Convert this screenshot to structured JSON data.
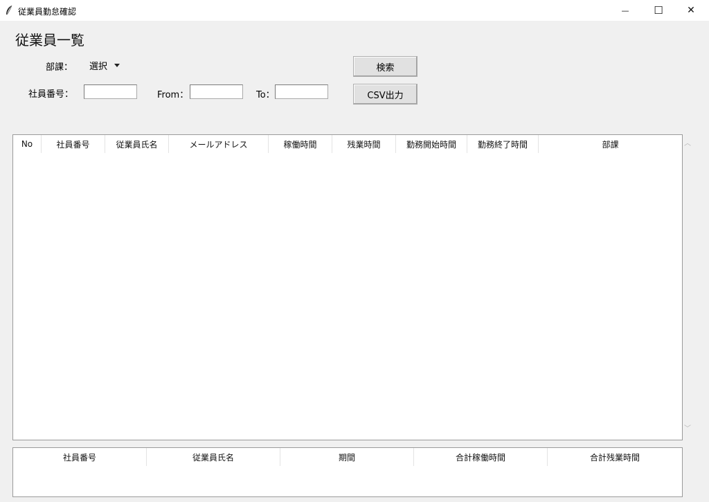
{
  "window": {
    "title": "従業員勤怠確認",
    "minimize_glyph": "—",
    "maximize_glyph": "☐",
    "close_glyph": "✕",
    "icon": "feather-icon"
  },
  "page": {
    "title": "従業員一覧"
  },
  "filters": {
    "dept_label": "部課：",
    "dept_selected": "選択",
    "employee_id_label": "社員番号：",
    "employee_id_value": "",
    "from_label": "From：",
    "from_value": "",
    "to_label": "To：",
    "to_value": ""
  },
  "buttons": {
    "search": "検索",
    "csv_export": "CSV出力"
  },
  "main_table": {
    "columns": [
      "No",
      "社員番号",
      "従業員氏名",
      "メールアドレス",
      "稼働時間",
      "残業時間",
      "勤務開始時間",
      "勤務終了時間",
      "部課"
    ],
    "rows": []
  },
  "summary_table": {
    "columns": [
      "社員番号",
      "従業員氏名",
      "期間",
      "合計稼働時間",
      "合計残業時間"
    ],
    "rows": []
  },
  "scrollbar": {
    "up_glyph": "︿",
    "down_glyph": "﹀"
  }
}
